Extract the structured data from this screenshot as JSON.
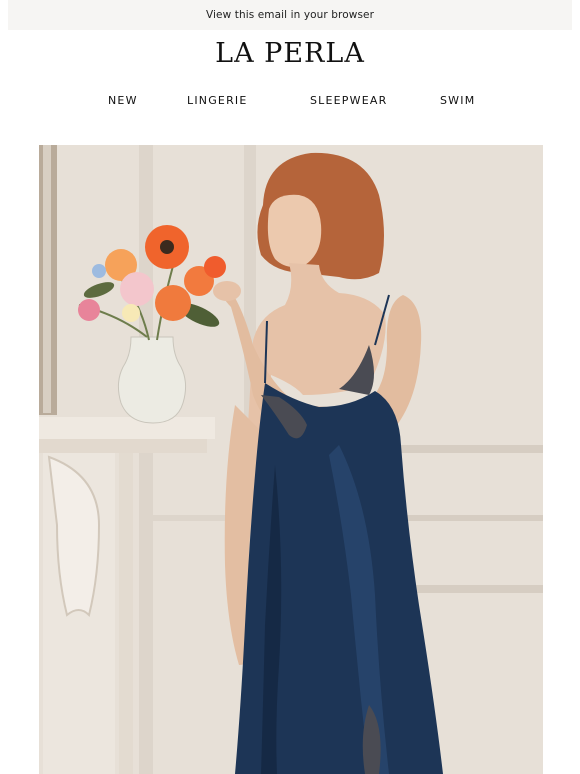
{
  "header": {
    "view_in_browser": "View this email in your browser",
    "brand": "LA PERLA"
  },
  "nav": {
    "items": [
      {
        "label": "NEW"
      },
      {
        "label": "LINGERIE"
      },
      {
        "label": "SLEEPWEAR"
      },
      {
        "label": "SWIM"
      }
    ]
  },
  "hero": {
    "colors": {
      "wall": "#e6dfd6",
      "slip": "#1d3556",
      "hair": "#b5643a",
      "skin": "#e6c2a8",
      "flowers_orange": "#f0642c"
    }
  }
}
